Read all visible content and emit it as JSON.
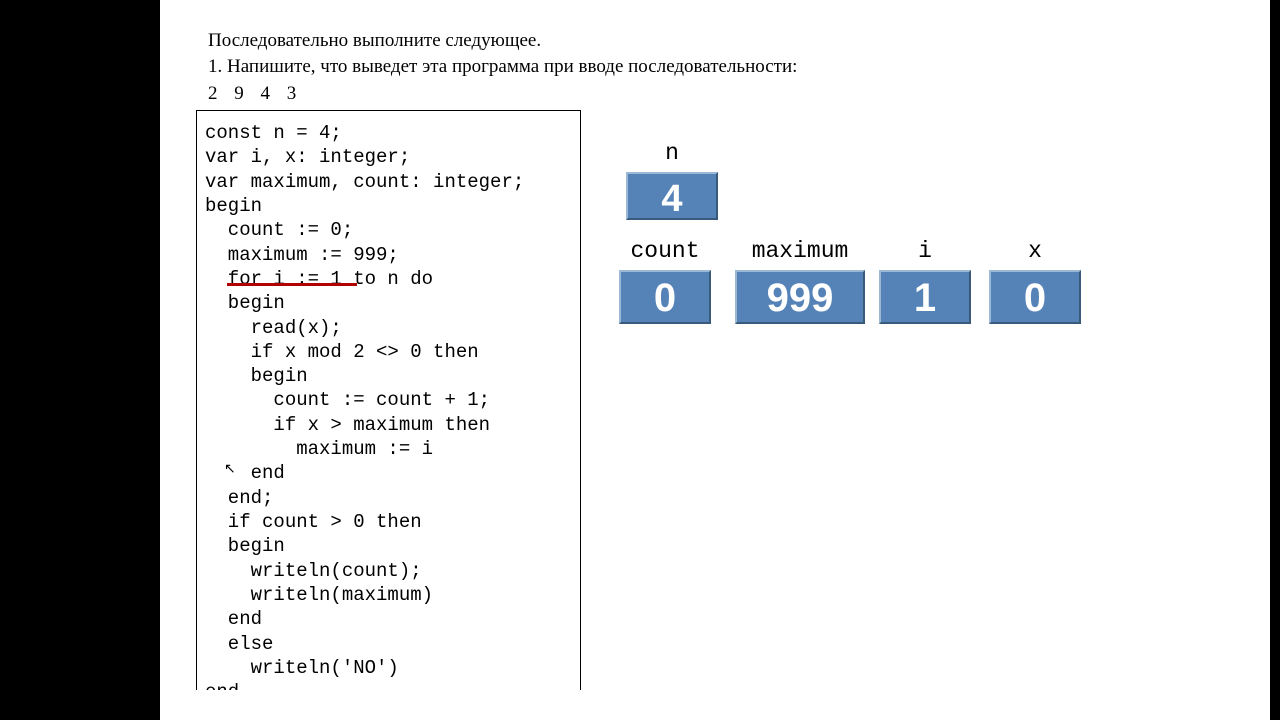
{
  "header": {
    "line1": "Последовательно выполните следующее.",
    "line2": "1. Напишите, что выведет эта программа при вводе последовательности:",
    "sequence": "2 9 4 3"
  },
  "code": {
    "lines": [
      "const n = 4;",
      "var i, x: integer;",
      "var maximum, count: integer;",
      "begin",
      "  count := 0;",
      "  maximum := 999;",
      "  for i := 1 to n do",
      "  begin",
      "    read(x);",
      "    if x mod 2 <> 0 then",
      "    begin",
      "      count := count + 1;",
      "      if x > maximum then",
      "        maximum := i",
      "    end",
      "  end;",
      "  if count > 0 then",
      "  begin",
      "    writeln(count);",
      "    writeln(maximum)",
      "  end",
      "  else",
      "    writeln('NO')",
      "end."
    ],
    "highlighted_line_index": 6
  },
  "variables": {
    "n": {
      "label": "n",
      "value": "4"
    },
    "count": {
      "label": "count",
      "value": "0"
    },
    "maximum": {
      "label": "maximum",
      "value": "999"
    },
    "i": {
      "label": "i",
      "value": "1"
    },
    "x": {
      "label": "x",
      "value": "0"
    }
  }
}
